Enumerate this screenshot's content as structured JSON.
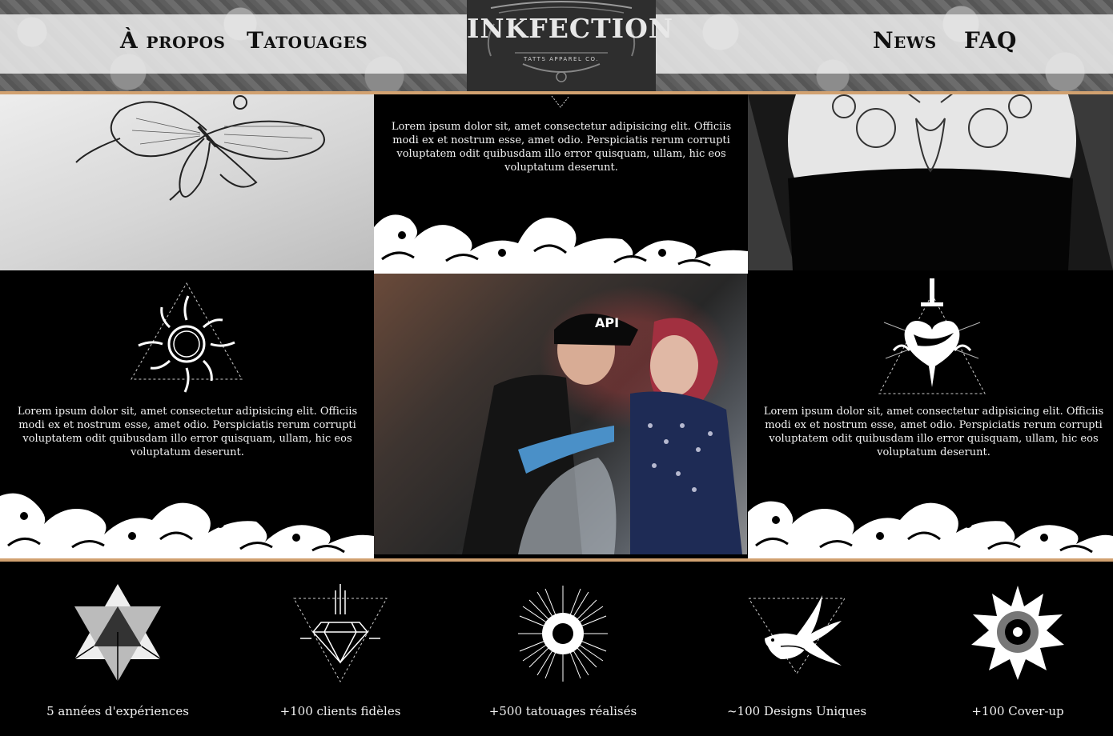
{
  "nav": {
    "left": [
      {
        "label": "À propos"
      },
      {
        "label": "Tatouages"
      }
    ],
    "right": [
      {
        "label": "News"
      },
      {
        "label": "FAQ"
      }
    ]
  },
  "logo": {
    "text": "INKFECTION",
    "tagline": "TATTS APPAREL CO."
  },
  "sections": {
    "top_text": "Lorem ipsum dolor sit, amet consectetur adipisicing elit. Officiis modi ex et nostrum esse, amet odio. Perspiciatis rerum corrupti voluptatem odit quibusdam illo error quisquam, ullam, hic eos voluptatum deserunt.",
    "left_text": "Lorem ipsum dolor sit, amet consectetur adipisicing elit. Officiis modi ex et nostrum esse, amet odio. Perspiciatis rerum corrupti voluptatem odit quibusdam illo error quisquam, ullam, hic eos voluptatum deserunt.",
    "right_text": "Lorem ipsum dolor sit, amet consectetur adipisicing elit. Officiis modi ex et nostrum esse, amet odio. Perspiciatis rerum corrupti voluptatem odit quibusdam illo error quisquam, ullam, hic eos voluptatum deserunt.",
    "studio_cap": "API"
  },
  "stats": [
    {
      "label": "5 années d'expériences",
      "icon": "merkaba-icon"
    },
    {
      "label": "+100 clients fidèles",
      "icon": "diamond-icon"
    },
    {
      "label": "+500 tatouages réalisés",
      "icon": "sunburst-icon"
    },
    {
      "label": "~100 Designs Uniques",
      "icon": "swallow-icon"
    },
    {
      "label": "+100 Cover-up",
      "icon": "dotwork-flower-icon"
    }
  ],
  "colors": {
    "accent": "#d1a170",
    "background": "#000000",
    "nav_band": "#ececec"
  }
}
